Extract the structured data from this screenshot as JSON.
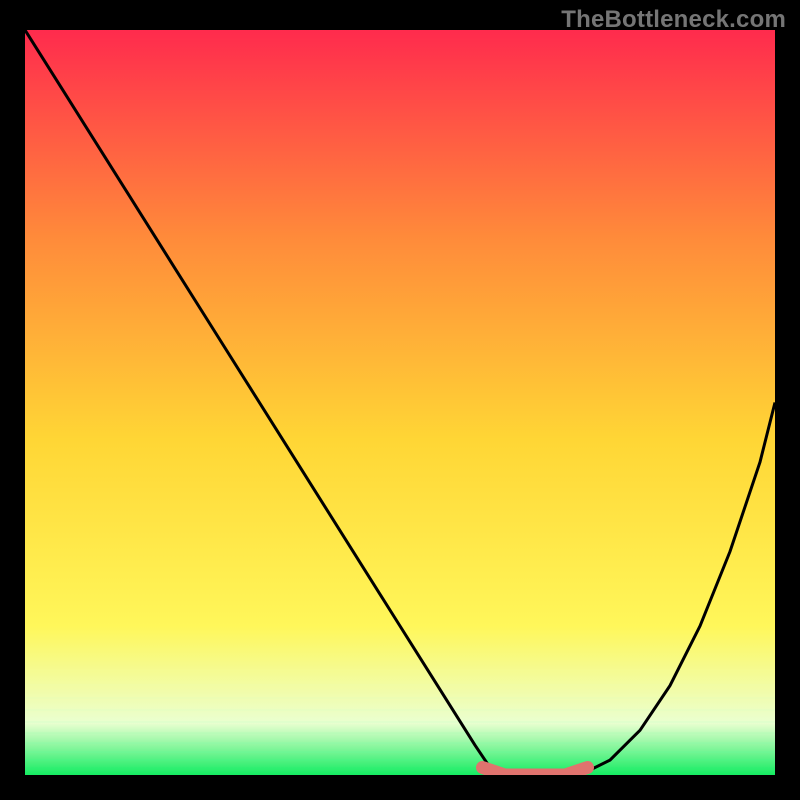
{
  "watermark": {
    "text": "TheBottleneck.com"
  },
  "chart_data": {
    "type": "line",
    "title": "",
    "xlabel": "",
    "ylabel": "",
    "xlim": [
      0,
      100
    ],
    "ylim": [
      0,
      100
    ],
    "grid": false,
    "legend": false,
    "background_gradient": {
      "top": "#ff2b4d",
      "mid_upper": "#ff8b3a",
      "mid": "#ffd635",
      "mid_lower": "#fff75a",
      "bottom_band": "#eaffd0",
      "bottom": "#15ec62"
    },
    "series": [
      {
        "name": "bottleneck-curve",
        "color": "#000000",
        "type": "line",
        "x": [
          0,
          5,
          10,
          15,
          20,
          25,
          30,
          35,
          40,
          45,
          50,
          55,
          60,
          62,
          65,
          70,
          74,
          78,
          82,
          86,
          90,
          94,
          98,
          100
        ],
        "y": [
          100,
          92,
          84,
          76,
          68,
          60,
          52,
          44,
          36,
          28,
          20,
          12,
          4,
          1,
          0,
          0,
          0,
          2,
          6,
          12,
          20,
          30,
          42,
          50
        ]
      },
      {
        "name": "optimal-zone",
        "color": "#e0736e",
        "type": "line",
        "x": [
          61,
          64,
          68,
          72,
          75
        ],
        "y": [
          1,
          0,
          0,
          0,
          1
        ]
      }
    ],
    "annotations": []
  }
}
